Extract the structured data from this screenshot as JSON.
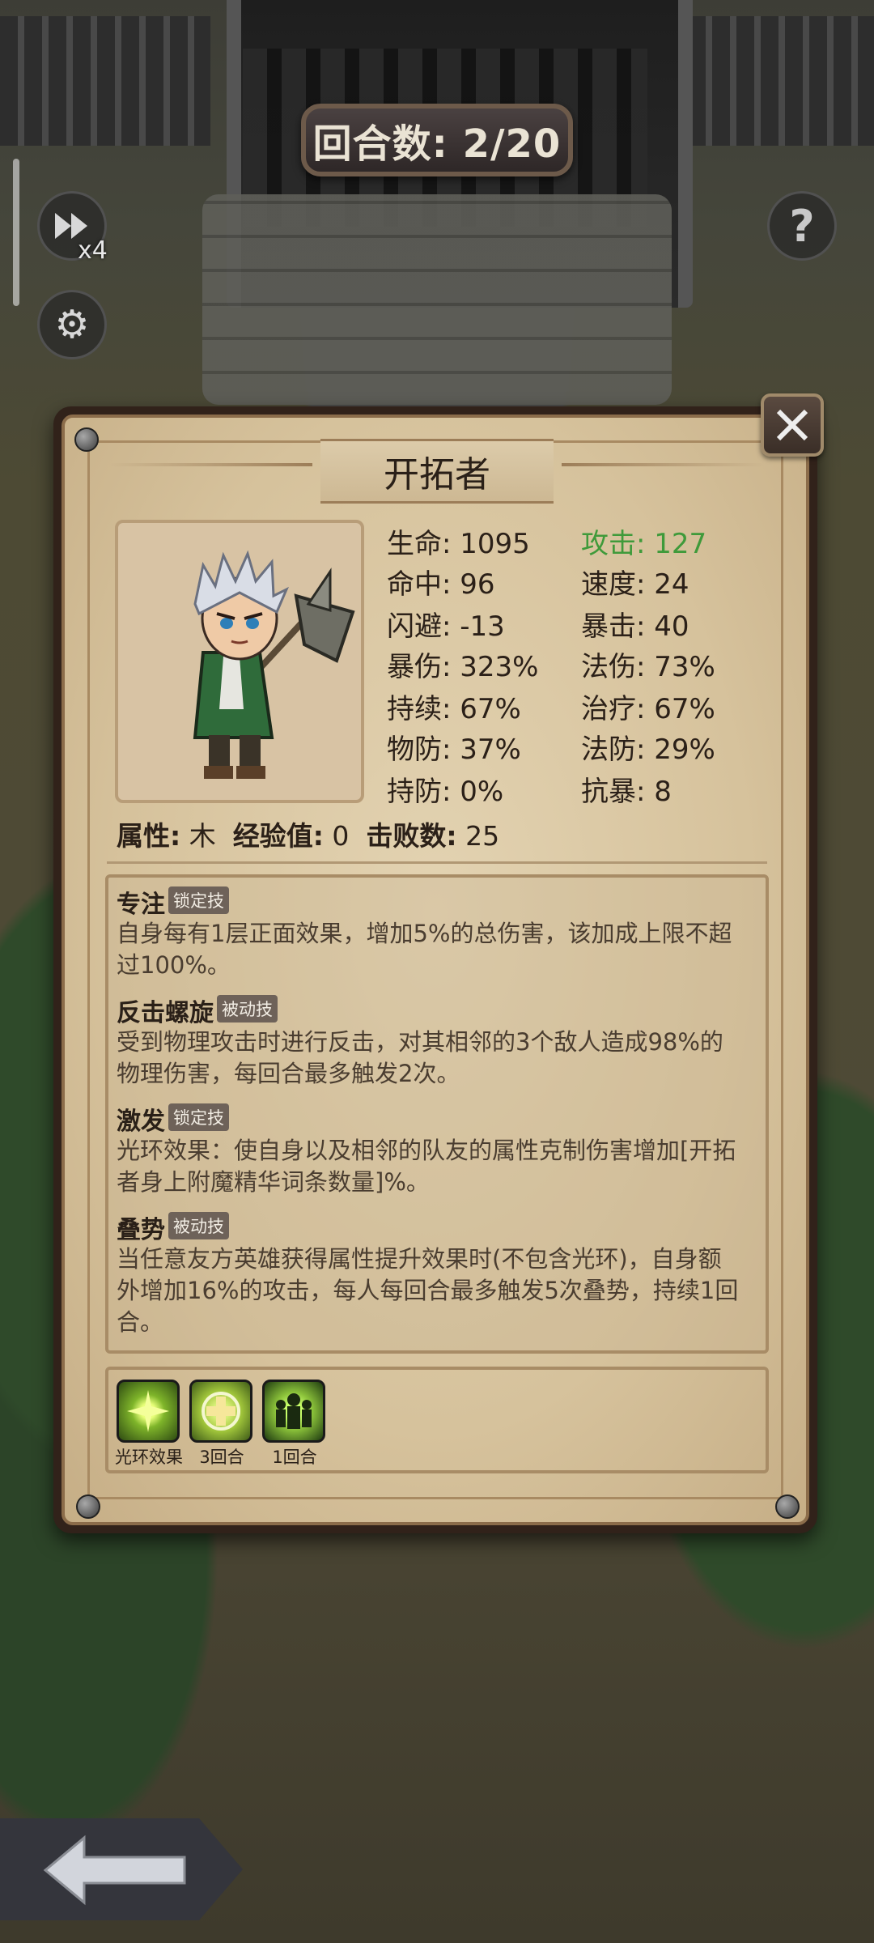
{
  "hud": {
    "round_counter": "回合数: 2/20",
    "speed_label": "x4"
  },
  "hero": {
    "name": "开拓者",
    "stats": {
      "hp_label": "生命: 1095",
      "attack_label": "攻击: 127",
      "hit_label": "命中: 96",
      "speed_label": "速度: 24",
      "dodge_label": "闪避: -13",
      "crit_label": "暴击: 40",
      "crit_dmg_label": "暴伤: 323%",
      "magic_dmg_label": "法伤: 73%",
      "duration_label": "持续: 67%",
      "heal_label": "治疗: 67%",
      "phys_def_label": "物防: 37%",
      "magic_def_label": "法防: 29%",
      "dot_def_label": "持防: 0%",
      "crit_res_label": "抗暴: 8"
    },
    "attribute_key": "属性:",
    "attribute_value": "木",
    "exp_key": "经验值:",
    "exp_value": "0",
    "kills_key": "击败数:",
    "kills_value": "25"
  },
  "skills": [
    {
      "name": "专注",
      "tag": "锁定技",
      "desc_line1": "自身每有1层正面效果，增加5%的总伤害，该加成上限不超",
      "desc_line2": "过100%。"
    },
    {
      "name": "反击螺旋",
      "tag": "被动技",
      "desc_line1": "受到物理攻击时进行反击，对其相邻的3个敌人造成98%的",
      "desc_line2": "物理伤害，每回合最多触发2次。"
    },
    {
      "name": "激发",
      "tag": "锁定技",
      "desc_line1": "光环效果：使自身以及相邻的队友的属性克制伤害增加[开拓",
      "desc_line2": "者身上附魔精华词条数量]%。"
    },
    {
      "name": "叠势",
      "tag": "被动技",
      "desc_line1": "当任意友方英雄获得属性提升效果时(不包含光环)，自身额",
      "desc_line2": "外增加16%的攻击，每人每回合最多触发5次叠势，持续1回",
      "desc_line3": "合。"
    }
  ],
  "buffs": [
    {
      "label": "光环效果",
      "icon": "aura-burst-icon",
      "color": "#7fb52a"
    },
    {
      "label": "3回合",
      "icon": "cross-shield-icon",
      "color": "#9fc43a"
    },
    {
      "label": "1回合",
      "icon": "figures-icon",
      "color": "#8bc23a"
    }
  ],
  "colors": {
    "attack_green": "#3f9a3a",
    "parchment": "#d6c29c",
    "panel_frame": "#31221a"
  }
}
